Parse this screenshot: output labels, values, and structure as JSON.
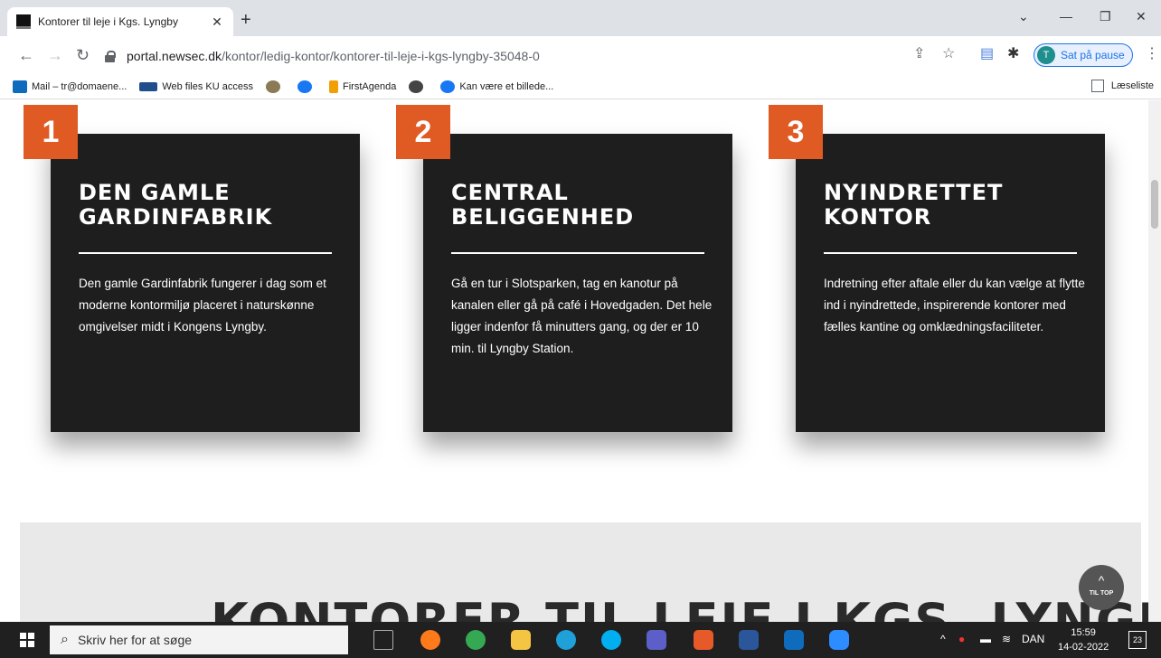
{
  "browser": {
    "tab_title": "Kontorer til leje i Kgs. Lyngby",
    "tab_close": "✕",
    "new_tab": "+",
    "url_host": "portal.newsec.dk",
    "url_path": "/kontor/ledig-kontor/kontorer-til-leje-i-kgs-lyngby-35048-0",
    "profile_initial": "T",
    "profile_label": "Sat på pause",
    "bookmarks": [
      {
        "label": "Mail – tr@domaene...",
        "icon": "outlook-icon",
        "color": "#0f6cbd"
      },
      {
        "label": "Web files KU access",
        "icon": "web-files-icon",
        "color": "#1f4e8c"
      },
      {
        "label": "",
        "icon": "ku-logo-icon",
        "color": "#8a7a55"
      },
      {
        "label": "",
        "icon": "facebook-icon",
        "color": "#1877f2"
      },
      {
        "label": "FirstAgenda",
        "icon": "firstagenda-icon",
        "color": "#f29f05"
      },
      {
        "label": "",
        "icon": "globe-icon",
        "color": "#444444"
      },
      {
        "label": "Kan være et billede...",
        "icon": "facebook-icon",
        "color": "#1877f2"
      }
    ],
    "reading_list": "Læseliste"
  },
  "cards": [
    {
      "number": "1",
      "title": "DEN GAMLE GARDINFABRIK",
      "text": "Den gamle Gardinfabrik fungerer i dag som et moderne kontormiljø placeret i naturskønne omgivelser midt i Kongens Lyngby."
    },
    {
      "number": "2",
      "title": "CENTRAL BELIGGENHED",
      "text": "Gå en tur i Slotsparken, tag en kanotur på kanalen eller gå på café i Hovedgaden. Det hele ligger indenfor få minutters gang, og der er 10 min. til Lyngby Station."
    },
    {
      "number": "3",
      "title": "NYINDRETTET KONTOR",
      "text": "Indretning efter aftale eller du kan vælge at flytte ind i nyindrettede, inspirerende kontorer med fælles kantine og omklædningsfaciliteter."
    }
  ],
  "section_title": "KONTORER TIL LEJE I KGS. LYNGBY",
  "to_top": {
    "arrow": "^",
    "label": "TIL TOP"
  },
  "taskbar": {
    "search_placeholder": "Skriv her for at søge",
    "language": "DAN",
    "time": "15:59",
    "date": "14-02-2022",
    "notifications": "23",
    "apps": [
      {
        "name": "task-view-icon",
        "color": "#202020"
      },
      {
        "name": "firefox-icon",
        "color": "#ff7a1a"
      },
      {
        "name": "chrome-icon",
        "color": "#34a853"
      },
      {
        "name": "file-explorer-icon",
        "color": "#f4c542"
      },
      {
        "name": "edge-icon",
        "color": "#1fa0d8"
      },
      {
        "name": "skype-icon",
        "color": "#00aff0"
      },
      {
        "name": "teams-icon",
        "color": "#5b5fc7"
      },
      {
        "name": "app-badge-icon",
        "color": "#e65a2a"
      },
      {
        "name": "word-icon",
        "color": "#2b579a"
      },
      {
        "name": "outlook-icon",
        "color": "#0f6cbd"
      },
      {
        "name": "zoom-icon",
        "color": "#2d8cff"
      }
    ]
  }
}
